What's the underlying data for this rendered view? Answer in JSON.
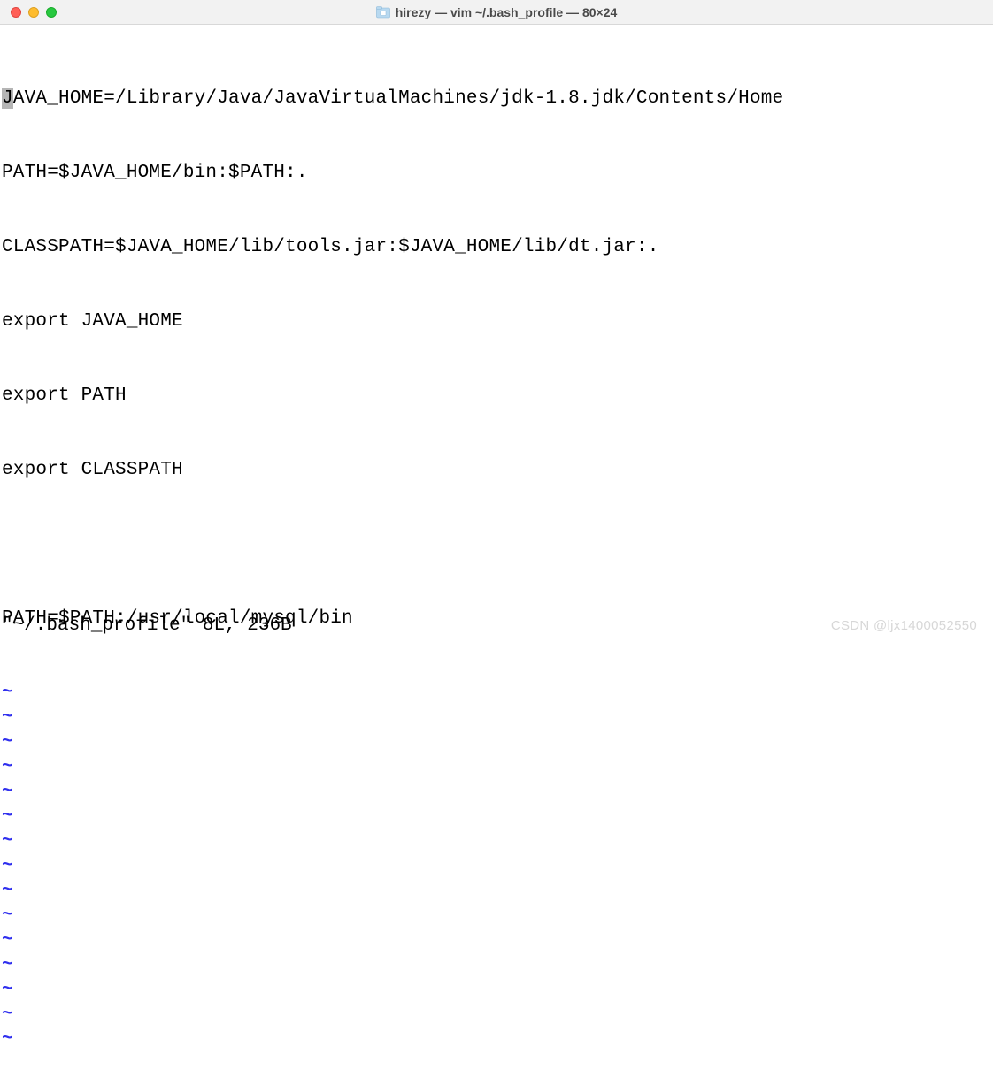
{
  "window": {
    "title": "hirezy — vim ~/.bash_profile — 80×24"
  },
  "editor": {
    "cursor_char": "J",
    "lines": [
      "AVA_HOME=/Library/Java/JavaVirtualMachines/jdk-1.8.jdk/Contents/Home",
      "PATH=$JAVA_HOME/bin:$PATH:.",
      "CLASSPATH=$JAVA_HOME/lib/tools.jar:$JAVA_HOME/lib/dt.jar:.",
      "export JAVA_HOME",
      "export PATH",
      "export CLASSPATH",
      "",
      "PATH=$PATH:/usr/local/mysql/bin"
    ],
    "tilde": "~",
    "tilde_count": 15,
    "status": "\"~/.bash_profile\" 8L, 236B"
  },
  "watermark": "CSDN @ljx1400052550"
}
